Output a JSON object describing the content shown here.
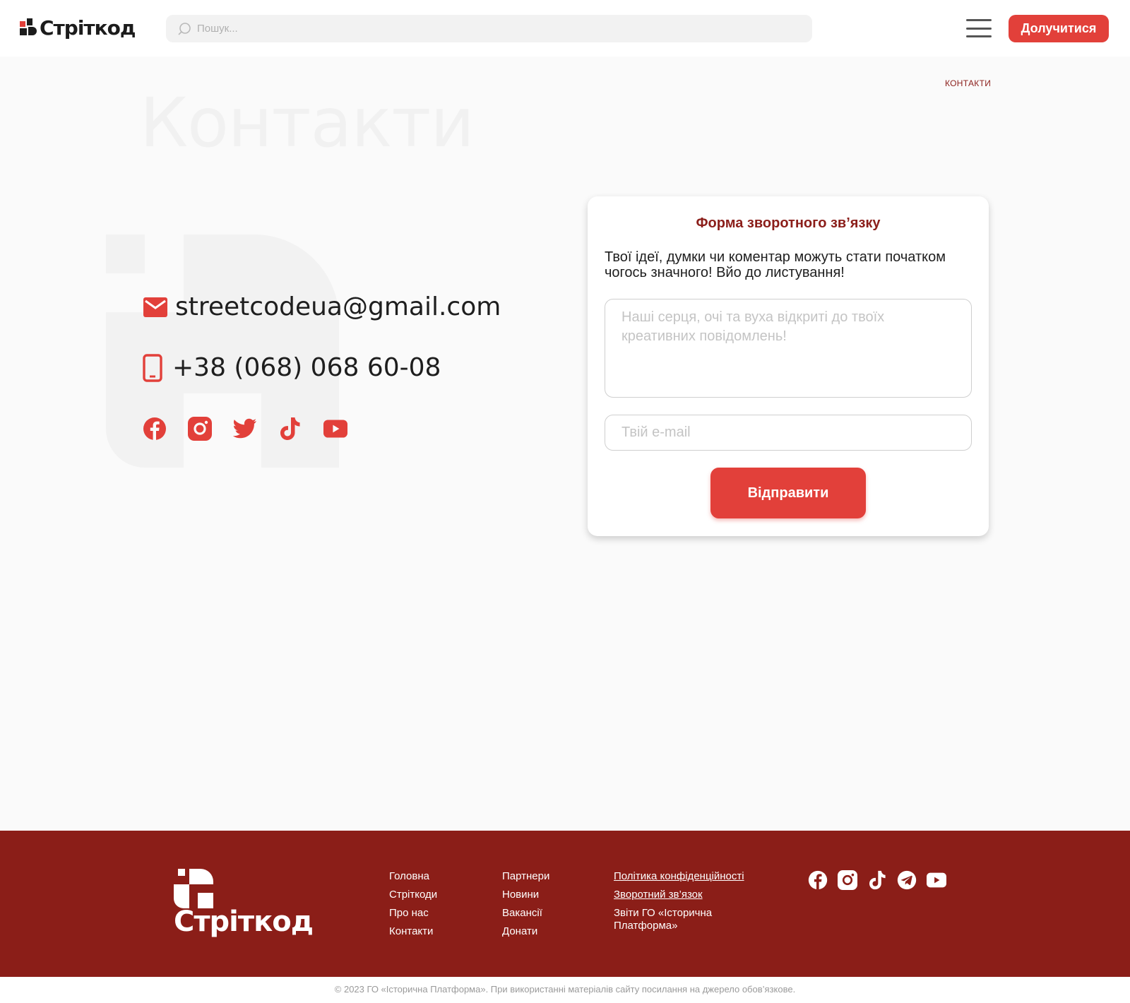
{
  "header": {
    "logo_text": "Стріткод",
    "search_placeholder": "Пошук...",
    "join_label": "Долучитися"
  },
  "breadcrumb": "КОНТАКТИ",
  "page_title": "Контакти",
  "contacts": {
    "email": "streetcodeua@gmail.com",
    "phone": "+38 (068) 068 60-08",
    "socials": [
      "facebook-icon",
      "instagram-icon",
      "twitter-icon",
      "tiktok-icon",
      "youtube-icon"
    ]
  },
  "form": {
    "title": "Форма зворотного зв’язку",
    "description": "Твої ідеї, думки чи коментар можуть стати початком чогось значного! Вйо до листування!",
    "message_placeholder": "Наші серця, очі та вуха відкриті до твоїх креативних повідомлень!",
    "email_placeholder": "Твій e-mail",
    "submit_label": "Відправити"
  },
  "footer": {
    "logo_text": "Стріткод",
    "col1": [
      "Головна",
      "Стріткоди",
      "Про нас",
      "Контакти"
    ],
    "col2": [
      "Партнери",
      "Новини",
      "Вакансії",
      "Донати"
    ],
    "col3": [
      "Політика конфіденційності",
      "Зворотний зв’язок",
      "Звіти ГО «Історична Платформа»"
    ],
    "socials": [
      "facebook-icon",
      "instagram-icon",
      "tiktok-icon",
      "telegram-icon",
      "youtube-icon"
    ]
  },
  "copyright": "© 2023 ГО «Історична Платформа». При використанні матеріалів сайту посилання на джерело обов’язкове.",
  "colors": {
    "accent": "#e2403a",
    "dark_red": "#8b1e18",
    "background": "#fafafa"
  }
}
